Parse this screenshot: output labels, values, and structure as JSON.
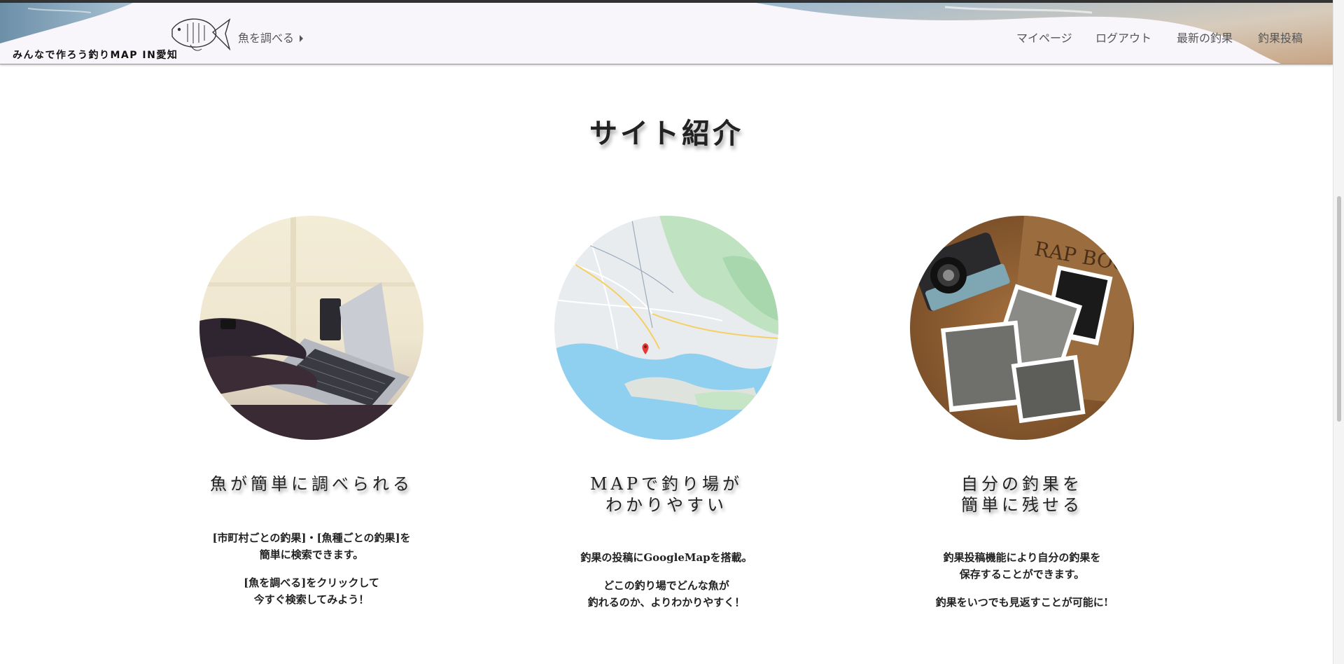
{
  "header": {
    "logo_text": "みんなで作ろう釣りMAP IN愛知",
    "fish_search_label": "魚を調べる",
    "nav": [
      {
        "label": "マイページ"
      },
      {
        "label": "ログアウト"
      },
      {
        "label": "最新の釣果"
      },
      {
        "label": "釣果投稿"
      }
    ]
  },
  "section": {
    "title": "サイト紹介"
  },
  "features": [
    {
      "image": "laptop-typing-photo",
      "title_lines": [
        "魚が簡単に調べられる"
      ],
      "paragraphs": [
        [
          "[市町村ごとの釣果]・[魚種ごとの釣果]を",
          "簡単に検索できます。"
        ],
        [
          "[魚を調べる]をクリックして",
          "今すぐ検索してみよう！"
        ]
      ]
    },
    {
      "image": "google-map-photo",
      "title_lines": [
        "MAPで釣り場が",
        "わかりやすい"
      ],
      "paragraphs": [
        [
          "釣果の投稿にGoogleMapを搭載。"
        ],
        [
          "どこの釣り場でどんな魚が",
          "釣れるのか、よりわかりやすく！"
        ]
      ]
    },
    {
      "image": "scrapbook-photos-photo",
      "title_lines": [
        "自分の釣果を",
        "簡単に残せる"
      ],
      "paragraphs": [
        [
          "釣果投稿機能により自分の釣果を",
          "保存することができます。"
        ],
        [
          "釣果をいつでも見返すことが可能に!"
        ]
      ]
    }
  ],
  "colors": {
    "header_bg": "#f8f5fb",
    "text": "#222222",
    "nav_text": "#555555"
  }
}
